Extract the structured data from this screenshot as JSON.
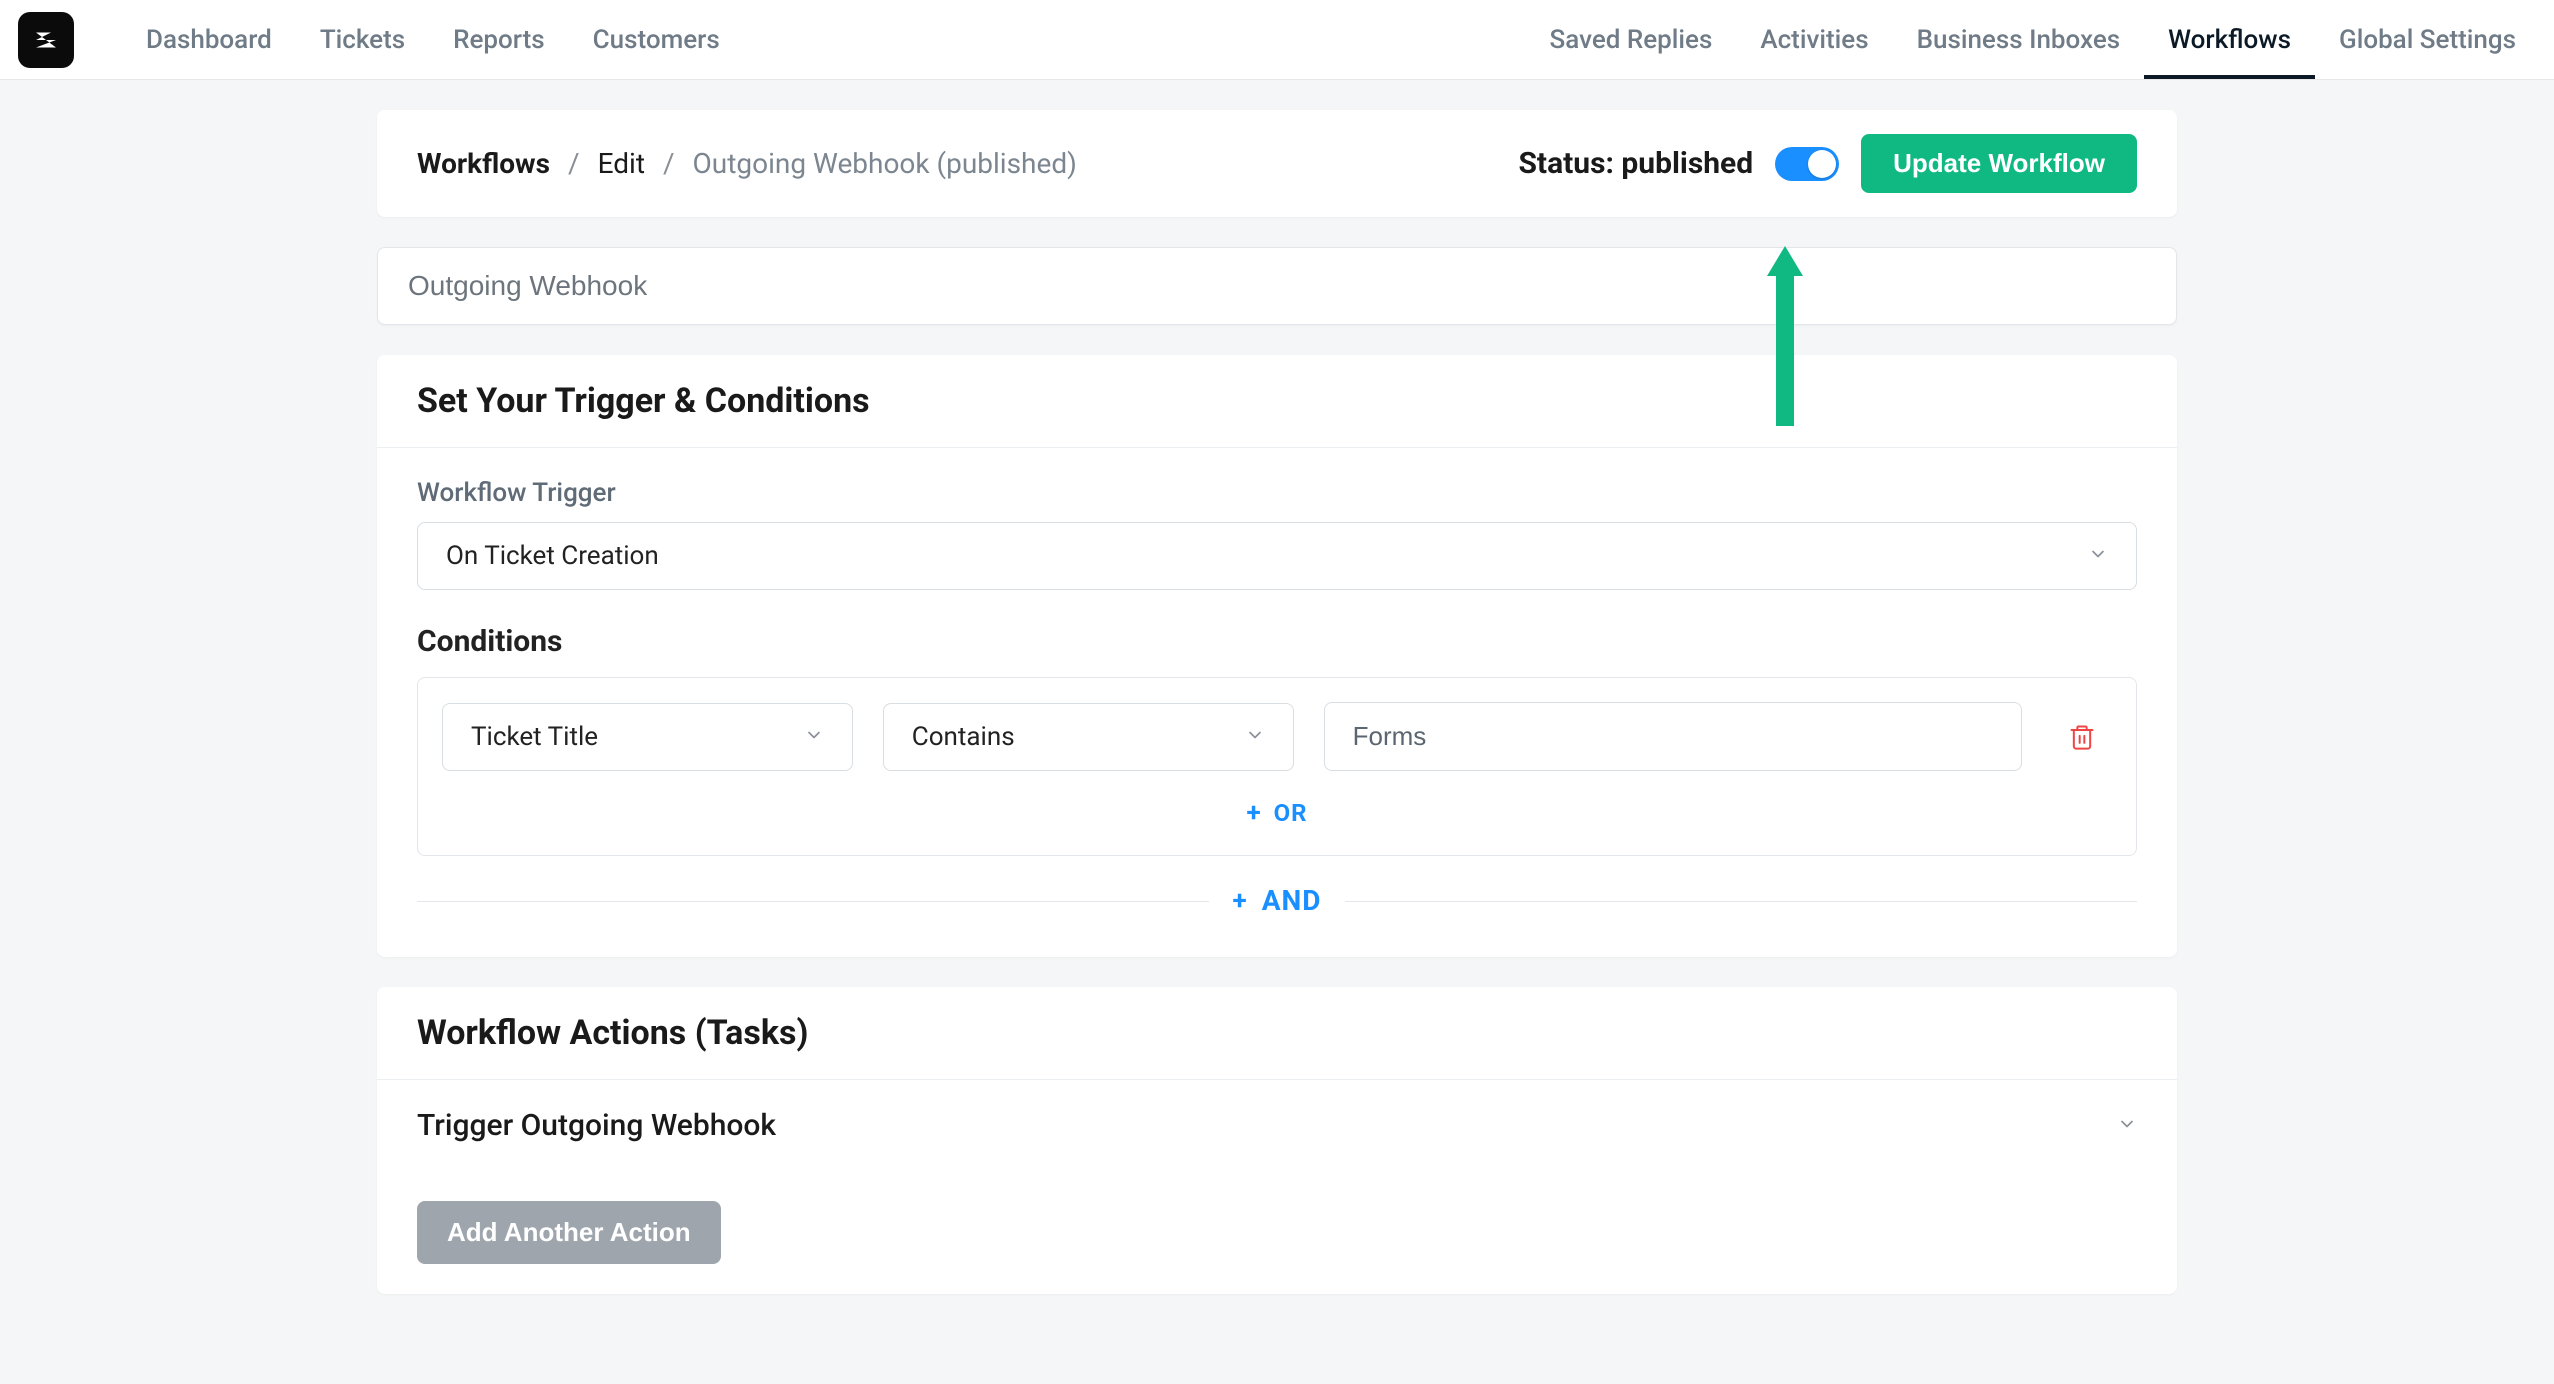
{
  "nav": {
    "left": [
      {
        "label": "Dashboard"
      },
      {
        "label": "Tickets"
      },
      {
        "label": "Reports"
      },
      {
        "label": "Customers"
      }
    ],
    "right": [
      {
        "label": "Saved Replies"
      },
      {
        "label": "Activities"
      },
      {
        "label": "Business Inboxes"
      },
      {
        "label": "Workflows",
        "active": true
      },
      {
        "label": "Global Settings"
      }
    ]
  },
  "breadcrumb": {
    "root": "Workflows",
    "edit": "Edit",
    "current": "Outgoing Webhook (published)"
  },
  "status_label": "Status: published",
  "update_btn": "Update Workflow",
  "workflow_name": "Outgoing Webhook",
  "trigger_section": {
    "title": "Set Your Trigger & Conditions",
    "trigger_label": "Workflow Trigger",
    "trigger_value": "On Ticket Creation",
    "conditions_label": "Conditions",
    "condition": {
      "field": "Ticket Title",
      "operator": "Contains",
      "value": "Forms"
    },
    "or_label": "OR",
    "and_label": "AND"
  },
  "actions_section": {
    "title": "Workflow Actions (Tasks)",
    "items": [
      {
        "label": "Trigger Outgoing Webhook"
      }
    ],
    "add_btn": "Add Another Action"
  },
  "icons": {
    "plus": "+"
  }
}
